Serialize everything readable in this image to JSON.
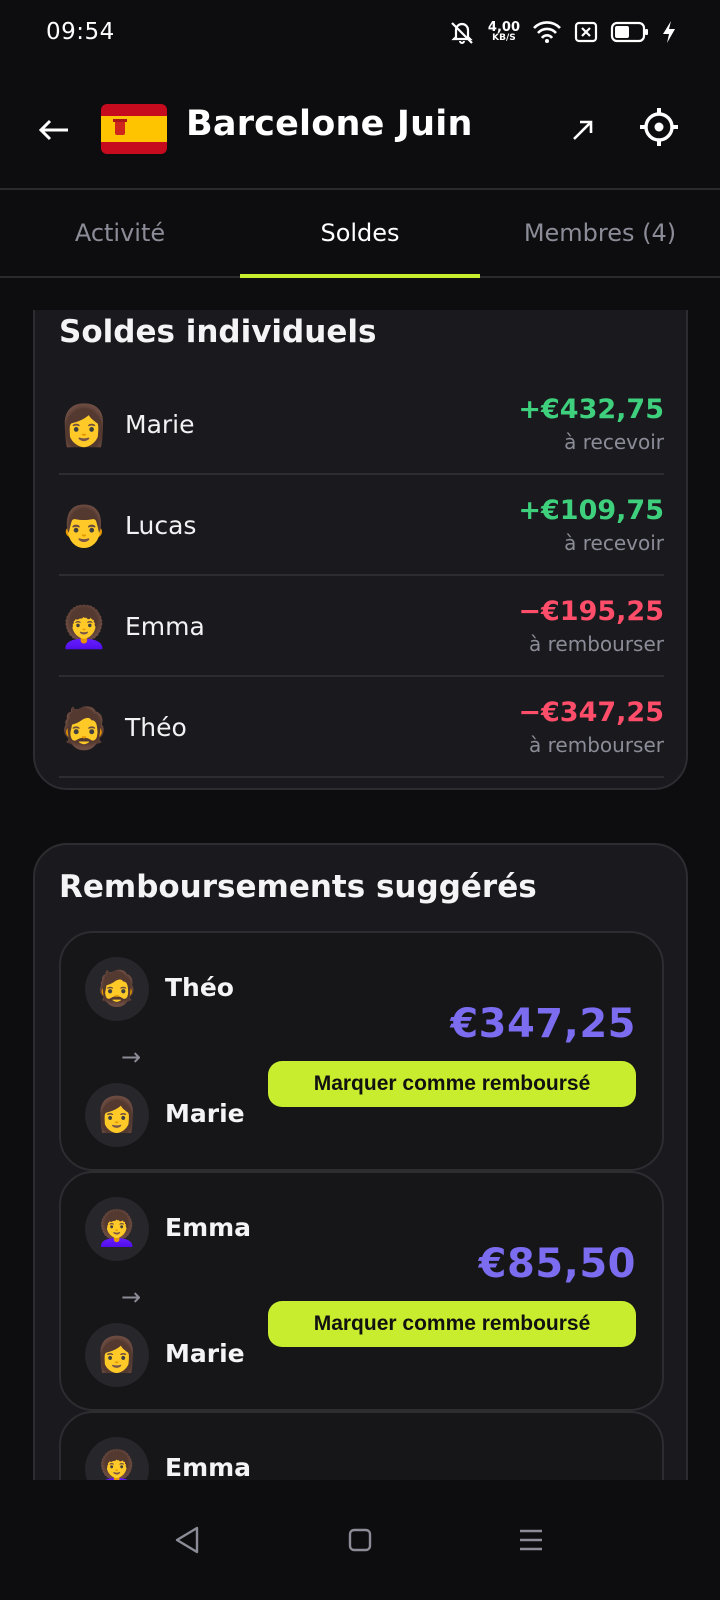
{
  "status_bar": {
    "time": "09:54",
    "net_speed_value": "4,00",
    "net_speed_unit": "KB/S",
    "icons": [
      "mute-icon",
      "net-speed",
      "wifi-icon",
      "sim-icon",
      "battery-icon",
      "charging-icon"
    ]
  },
  "header": {
    "title": "Barcelone Juin",
    "flag": "spain-flag",
    "back_icon": "back-arrow-icon",
    "share_icon": "share-arrow-icon",
    "settings_icon": "settings-icon"
  },
  "tabs": [
    {
      "label": "Activité",
      "active": false
    },
    {
      "label": "Soldes",
      "active": true
    },
    {
      "label": "Membres (4)",
      "active": false
    }
  ],
  "balances": {
    "title": "Soldes individuels",
    "rows": [
      {
        "avatar": "👩",
        "name": "Marie",
        "amount": "+€432,75",
        "status": "à recevoir",
        "kind": "positive"
      },
      {
        "avatar": "👨",
        "name": "Lucas",
        "amount": "+€109,75",
        "status": "à recevoir",
        "kind": "positive"
      },
      {
        "avatar": "👩‍🦱",
        "name": "Emma",
        "amount": "−€195,25",
        "status": "à rembourser",
        "kind": "negative"
      },
      {
        "avatar": "🧔",
        "name": "Théo",
        "amount": "−€347,25",
        "status": "à rembourser",
        "kind": "negative"
      }
    ]
  },
  "suggestions": {
    "title": "Remboursements suggérés",
    "arrow": "→",
    "button_label": "Marquer comme remboursé",
    "items": [
      {
        "from_avatar": "🧔",
        "from": "Théo",
        "to_avatar": "👩",
        "to": "Marie",
        "amount": "€347,25"
      },
      {
        "from_avatar": "👩‍🦱",
        "from": "Emma",
        "to_avatar": "👩",
        "to": "Marie",
        "amount": "€85,50"
      },
      {
        "from_avatar": "👩‍🦱",
        "from": "Emma"
      }
    ]
  },
  "colors": {
    "accent": "#c8ec2e",
    "positive": "#3ed07d",
    "negative": "#ff4d6a",
    "amount_purple": "#7b6cf0",
    "background": "#0d0d0f",
    "card": "#1a1a1e"
  },
  "nav": [
    "back-triangle-icon",
    "home-square-icon",
    "menu-lines-icon"
  ]
}
